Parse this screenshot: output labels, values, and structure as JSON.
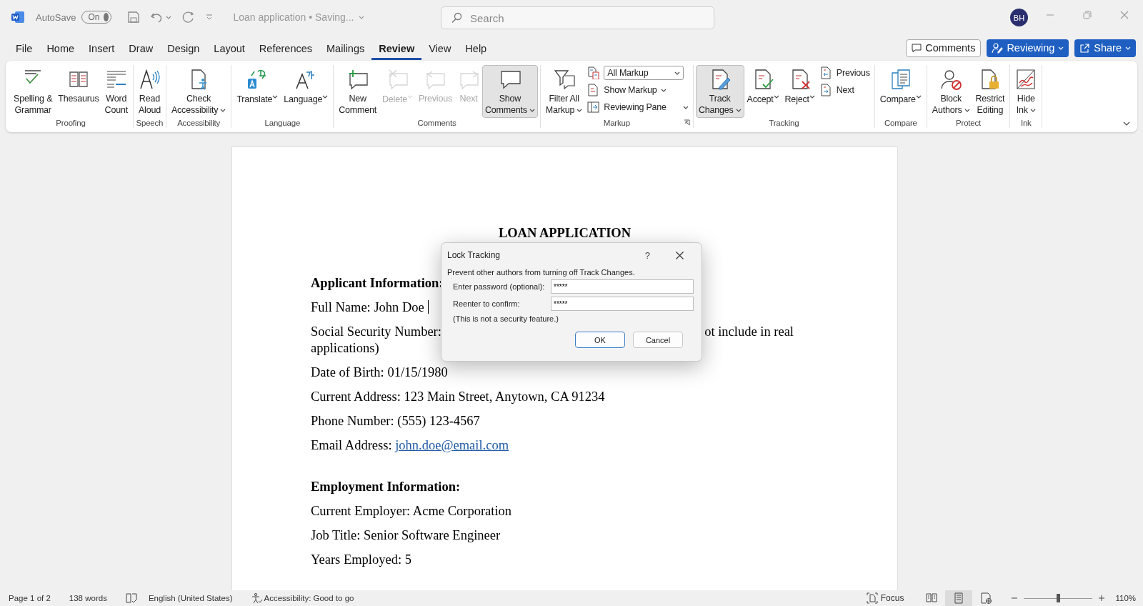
{
  "title_bar": {
    "autosave_label": "AutoSave",
    "autosave": {
      "label": "On",
      "on": true
    },
    "document_title": "Loan application • Saving...",
    "search": {
      "placeholder": "Search"
    },
    "avatar": "BH"
  },
  "menu_tabs": [
    {
      "label": "File",
      "selected": false
    },
    {
      "label": "Home",
      "selected": false
    },
    {
      "label": "Insert",
      "selected": false
    },
    {
      "label": "Draw",
      "selected": false
    },
    {
      "label": "Design",
      "selected": false
    },
    {
      "label": "Layout",
      "selected": false
    },
    {
      "label": "References",
      "selected": false
    },
    {
      "label": "Mailings",
      "selected": false
    },
    {
      "label": "Review",
      "selected": true
    },
    {
      "label": "View",
      "selected": false
    },
    {
      "label": "Help",
      "selected": false
    }
  ],
  "header_buttons": {
    "comments": "Comments",
    "reviewing": "Reviewing",
    "share": "Share"
  },
  "ribbon": {
    "groups": [
      {
        "label": "Proofing",
        "items": [
          {
            "kind": "large",
            "label": "Spelling &\nGrammar",
            "pressed": false,
            "disabled": false,
            "dropdown": false
          },
          {
            "kind": "large",
            "label": "Thesaurus",
            "pressed": false,
            "disabled": false,
            "dropdown": false
          },
          {
            "kind": "large",
            "label": "Word\nCount",
            "pressed": false,
            "disabled": false,
            "dropdown": false
          }
        ]
      },
      {
        "label": "Speech",
        "items": [
          {
            "kind": "large",
            "label": "Read\nAloud",
            "pressed": false,
            "disabled": false,
            "dropdown": false
          }
        ]
      },
      {
        "label": "Accessibility",
        "items": [
          {
            "kind": "large",
            "label": "Check\nAccessibility",
            "pressed": false,
            "disabled": false,
            "dropdown": true
          }
        ]
      },
      {
        "label": "Language",
        "items": [
          {
            "kind": "large",
            "label": "Translate",
            "pressed": false,
            "disabled": false,
            "dropdown": true
          },
          {
            "kind": "large",
            "label": "Language",
            "pressed": false,
            "disabled": false,
            "dropdown": true
          }
        ]
      },
      {
        "label": "Comments",
        "items": [
          {
            "kind": "large",
            "label": "New\nComment",
            "pressed": false,
            "disabled": false,
            "dropdown": false
          },
          {
            "kind": "large",
            "label": "Delete",
            "pressed": false,
            "disabled": true,
            "dropdown": true
          },
          {
            "kind": "large",
            "label": "Previous",
            "pressed": false,
            "disabled": true,
            "dropdown": false
          },
          {
            "kind": "large",
            "label": "Next",
            "pressed": false,
            "disabled": true,
            "dropdown": false
          },
          {
            "kind": "large",
            "label": "Show\nComments",
            "pressed": true,
            "disabled": false,
            "dropdown": true
          }
        ]
      },
      {
        "label": "Markup",
        "items": [
          {
            "kind": "large",
            "label": "Filter All\nMarkup",
            "pressed": false,
            "disabled": false,
            "dropdown": true
          },
          {
            "kind": "select",
            "label": "All Markup",
            "pressed": false,
            "disabled": false,
            "dropdown": true
          },
          {
            "kind": "small",
            "label": "Show Markup",
            "pressed": false,
            "disabled": false,
            "dropdown": true
          },
          {
            "kind": "small",
            "label": "Reviewing Pane",
            "pressed": false,
            "disabled": false,
            "dropdown": true
          }
        ]
      },
      {
        "label": "Tracking",
        "items": [
          {
            "kind": "large",
            "label": "Track\nChanges",
            "pressed": true,
            "disabled": false,
            "dropdown": true
          },
          {
            "kind": "large",
            "label": "Accept",
            "pressed": false,
            "disabled": false,
            "dropdown": true
          },
          {
            "kind": "large",
            "label": "Reject",
            "pressed": false,
            "disabled": false,
            "dropdown": true
          },
          {
            "kind": "small",
            "label": "Previous",
            "pressed": false,
            "disabled": false,
            "dropdown": false
          },
          {
            "kind": "small",
            "label": "Next",
            "pressed": false,
            "disabled": false,
            "dropdown": false
          }
        ]
      },
      {
        "label": "Compare",
        "items": [
          {
            "kind": "large",
            "label": "Compare",
            "pressed": false,
            "disabled": false,
            "dropdown": true
          }
        ]
      },
      {
        "label": "Protect",
        "items": [
          {
            "kind": "large",
            "label": "Block\nAuthors",
            "pressed": false,
            "disabled": false,
            "dropdown": true
          },
          {
            "kind": "large",
            "label": "Restrict\nEditing",
            "pressed": false,
            "disabled": false,
            "dropdown": false
          }
        ]
      },
      {
        "label": "Ink",
        "items": [
          {
            "kind": "large",
            "label": "Hide\nInk",
            "pressed": false,
            "disabled": false,
            "dropdown": true
          }
        ]
      }
    ]
  },
  "document": {
    "paragraphs": [
      {
        "kind": "title",
        "text": "LOAN APPLICATION"
      },
      {
        "kind": "heading",
        "text": "Applicant Information:"
      },
      {
        "kind": "text",
        "text": "Full Name: John Doe",
        "caret": true
      },
      {
        "kind": "covered",
        "text": "Social Security Number:",
        "tail": "ot include in real",
        "continuation": "applications)"
      },
      {
        "kind": "text",
        "text": "Date of Birth: 01/15/1980",
        "caret": false
      },
      {
        "kind": "text",
        "text": "Current Address: 123 Main Street, Anytown, CA 91234",
        "caret": false
      },
      {
        "kind": "text",
        "text": "Phone Number: (555) 123-4567",
        "caret": false
      },
      {
        "kind": "link",
        "text": "Email Address:",
        "link": "john.doe@email.com"
      },
      {
        "kind": "heading",
        "text": "Employment Information:"
      },
      {
        "kind": "text",
        "text": "Current Employer: Acme Corporation",
        "caret": false
      },
      {
        "kind": "text",
        "text": "Job Title: Senior Software Engineer",
        "caret": false
      },
      {
        "kind": "text",
        "text": "Years Employed: 5",
        "caret": false
      }
    ]
  },
  "dialog": {
    "title": "Lock Tracking",
    "help": "?",
    "message": "Prevent other authors from turning off Track Changes.",
    "fields": [
      {
        "label": "Enter password (optional):",
        "value": "*****"
      },
      {
        "label": "Reenter to confirm:",
        "value": "*****"
      }
    ],
    "note": "(This is not a security feature.)",
    "buttons": [
      {
        "label": "OK",
        "default": true
      },
      {
        "label": "Cancel",
        "default": false
      }
    ]
  },
  "status_bar": {
    "page": "Page 1 of 2",
    "words": "138 words",
    "language": "English (United States)",
    "accessibility": "Accessibility: Good to go",
    "focus": "Focus",
    "views": [
      {
        "kind": "read",
        "selected": false
      },
      {
        "kind": "print",
        "selected": true
      },
      {
        "kind": "web",
        "selected": false
      }
    ],
    "zoom": {
      "level": 0.5,
      "reading": "110%"
    }
  }
}
